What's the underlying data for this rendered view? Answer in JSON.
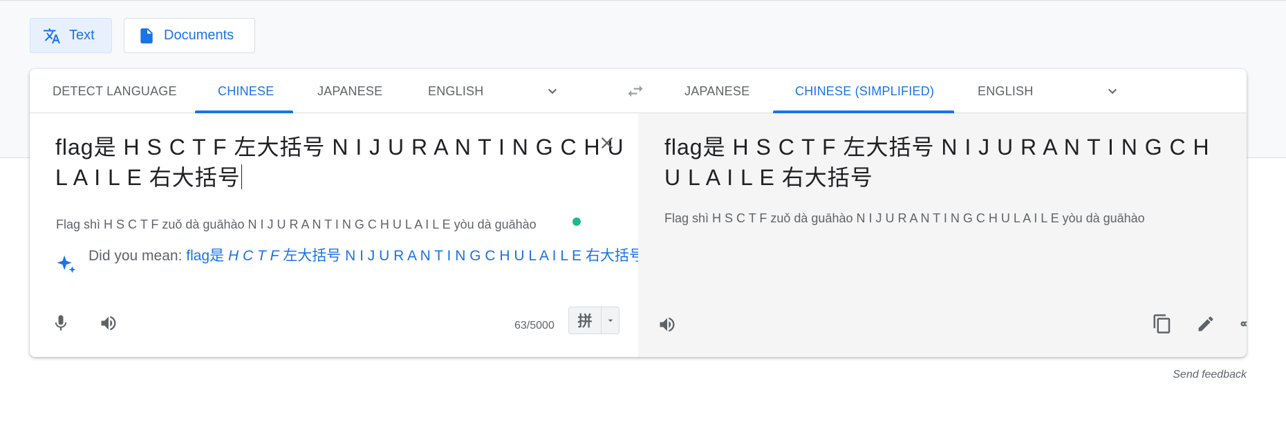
{
  "modes": {
    "text_label": "Text",
    "documents_label": "Documents"
  },
  "source_tabs": [
    "Detect language",
    "Chinese",
    "Japanese",
    "English"
  ],
  "source_active_tab": "Chinese",
  "target_tabs": [
    "Japanese",
    "Chinese (Simplified)",
    "English"
  ],
  "target_active_tab": "Chinese (Simplified)",
  "source": {
    "text_line1": "flag是 H S C T F 左大括号 N I J U R A N T I N G C H U",
    "text_line2": "L A I L E 右大括号",
    "transliteration": "Flag shì H S C T F zuǒ dà guāhào N I J U R A N T I N G C H U L A I L E yòu dà guāhào",
    "did_you_mean_prefix": "Did you mean: ",
    "did_you_mean_a": "flag是 ",
    "did_you_mean_italic": "H C T F",
    "did_you_mean_b": "左大括号 N I J U R A N T I N G C H U L A I L E 右大括号",
    "char_count": "63/5000",
    "ime_label": "拼"
  },
  "target": {
    "text_line1": "flag是 H S C T F 左大括号 N I J U R A N T I N G C H",
    "text_line2": "U L A I L E 右大括号",
    "transliteration": "Flag shì H S C T F zuǒ dà guāhào N I J U R A N T I N G C H U L A I L E yòu dà guāhào"
  },
  "footer": {
    "send_feedback": "Send feedback"
  },
  "colors": {
    "accent": "#1a73e8",
    "status_dot": "#1db88f"
  }
}
